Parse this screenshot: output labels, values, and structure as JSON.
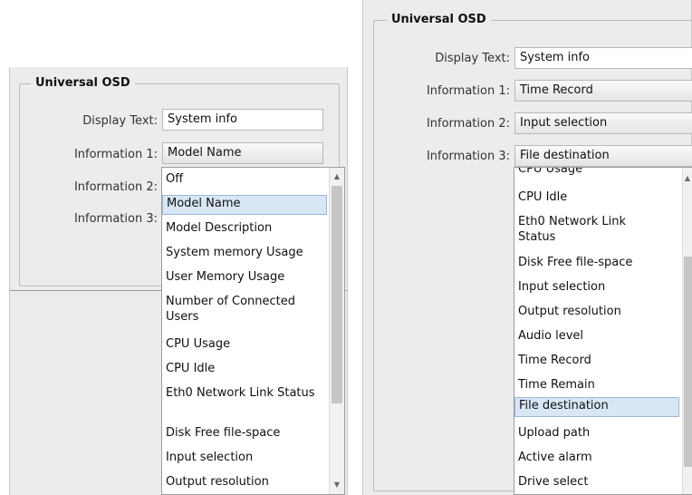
{
  "left": {
    "legend": "Universal OSD",
    "display_text_label": "Display Text:",
    "display_text_value": "System info",
    "info1_label": "Information 1:",
    "info1_value": "Model Name",
    "info2_label": "Information 2:",
    "info3_label": "Information 3:",
    "dropdown_options": [
      "Off",
      "Model Name",
      "Model Description",
      "System memory Usage",
      "User Memory Usage",
      "Number of Connected Users",
      "CPU Usage",
      "CPU Idle",
      "Eth0 Network Link Status",
      "Disk Free file-space",
      "Input selection",
      "Output resolution"
    ],
    "selected": "Model Name"
  },
  "right": {
    "legend": "Universal OSD",
    "display_text_label": "Display Text:",
    "display_text_value": "System info",
    "info1_label": "Information 1:",
    "info1_value": "Time Record",
    "info2_label": "Information 2:",
    "info2_value": "Input selection",
    "info3_label": "Information 3:",
    "info3_value": "File destination",
    "dropdown_options": [
      "CPU Usage",
      "CPU Idle",
      "Eth0 Network Link Status",
      "Disk Free file-space",
      "Input selection",
      "Output resolution",
      "Audio level",
      "Time Record",
      "Time Remain",
      "File destination",
      "Upload path",
      "Active alarm",
      "Drive select"
    ],
    "selected": "File destination"
  },
  "icons": {
    "scroll_up": "scroll-up-arrow-icon",
    "scroll_down": "scroll-down-arrow-icon"
  }
}
